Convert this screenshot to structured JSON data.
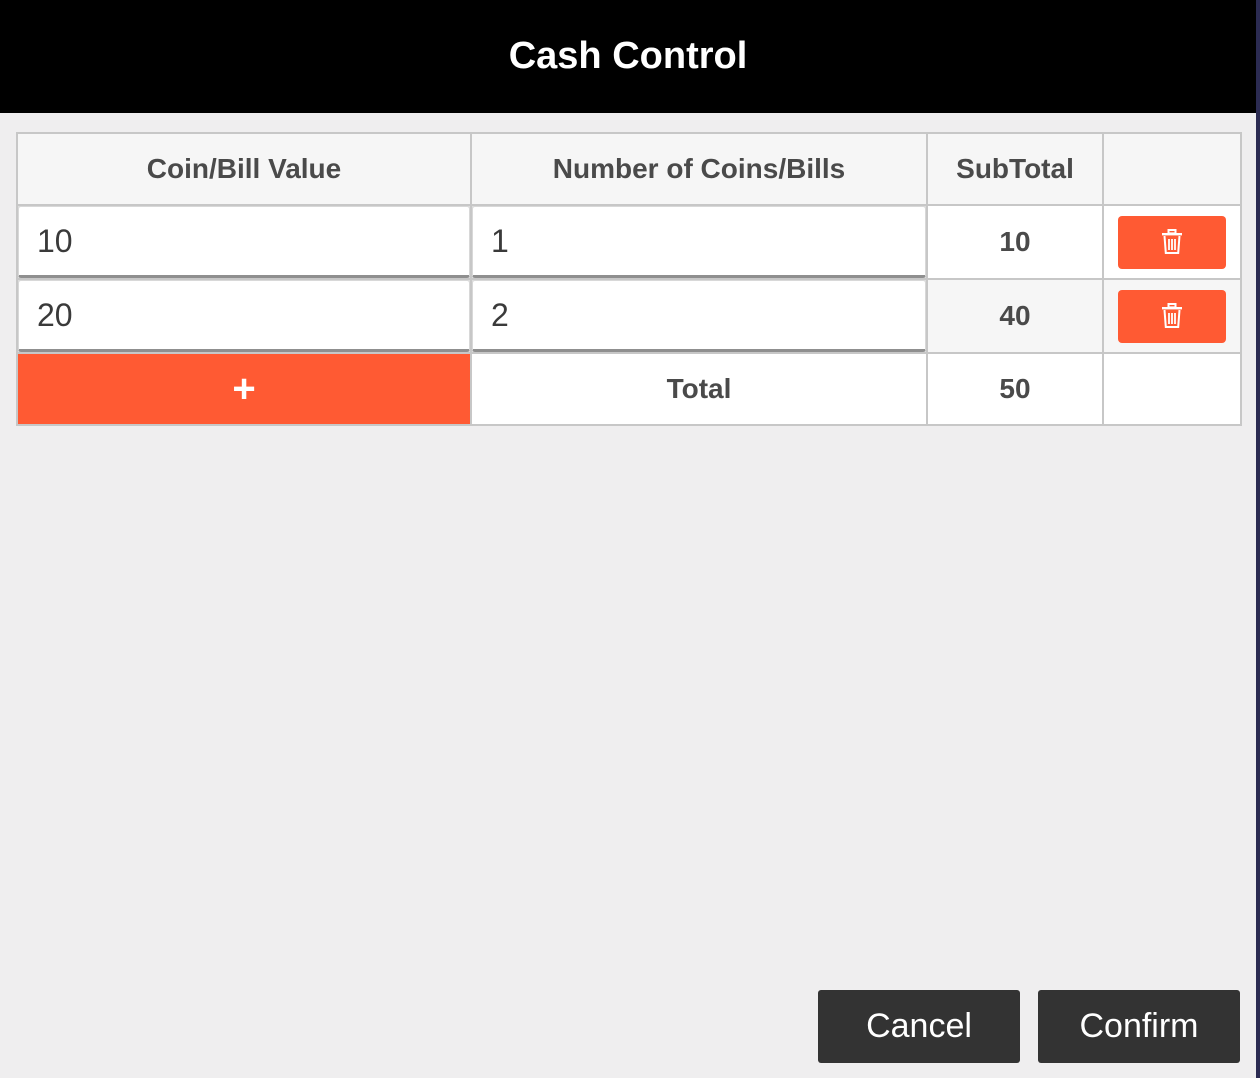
{
  "dialog": {
    "title": "Cash Control"
  },
  "table": {
    "headers": [
      "Coin/Bill Value",
      "Number of Coins/Bills",
      "SubTotal",
      ""
    ],
    "rows": [
      {
        "value": "10",
        "count": "1",
        "subtotal": "10"
      },
      {
        "value": "20",
        "count": "2",
        "subtotal": "40"
      }
    ],
    "add_symbol": "+",
    "total_label": "Total",
    "total_value": "50"
  },
  "buttons": {
    "cancel": "Cancel",
    "confirm": "Confirm"
  },
  "colors": {
    "accent": "#ff5a33",
    "header_bg": "#000000",
    "button_bg": "#333333"
  },
  "icons": {
    "delete": "trash-icon",
    "add": "plus-icon"
  }
}
